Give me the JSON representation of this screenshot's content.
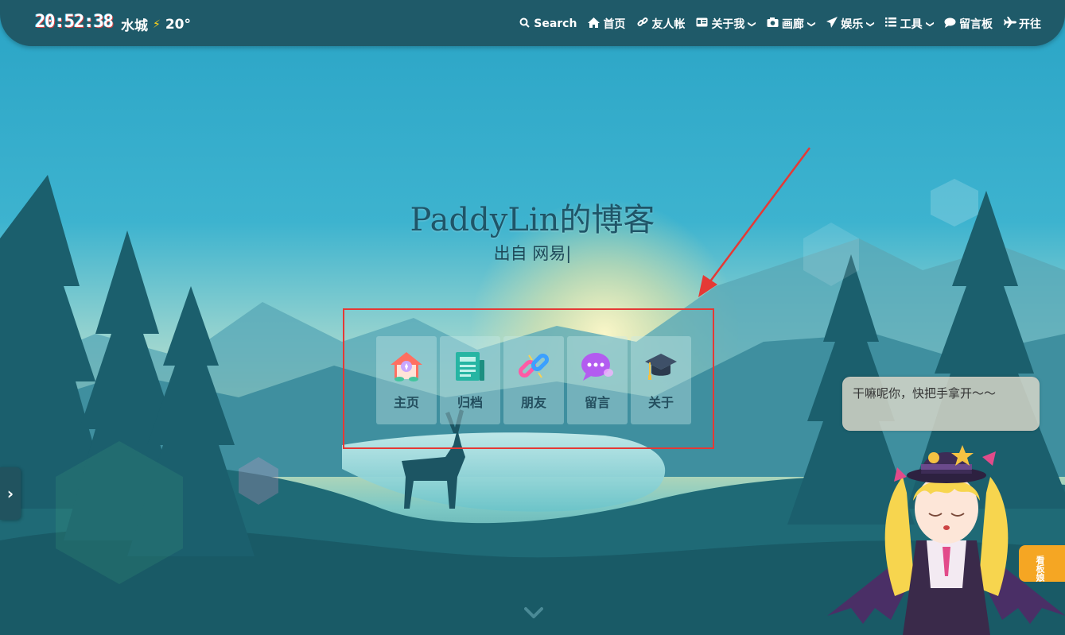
{
  "status": {
    "clock": "20:52:38",
    "city": "水城",
    "temperature": "20°"
  },
  "nav": {
    "items": [
      {
        "label": "Search",
        "icon": "search-icon",
        "dropdown": false
      },
      {
        "label": "首页",
        "icon": "home-icon",
        "dropdown": false
      },
      {
        "label": "友人帐",
        "icon": "link-icon",
        "dropdown": false
      },
      {
        "label": "关于我",
        "icon": "id-card-icon",
        "dropdown": true
      },
      {
        "label": "画廊",
        "icon": "camera-icon",
        "dropdown": true
      },
      {
        "label": "娱乐",
        "icon": "paper-plane-icon",
        "dropdown": true
      },
      {
        "label": "工具",
        "icon": "list-icon",
        "dropdown": true
      },
      {
        "label": "留言板",
        "icon": "comment-icon",
        "dropdown": false
      },
      {
        "label": "开往",
        "icon": "plane-icon",
        "dropdown": false
      }
    ]
  },
  "hero": {
    "title": "PaddyLin的博客",
    "subtitle": "出自 网易",
    "cursor": "|"
  },
  "quick_links": [
    {
      "label": "主页",
      "icon": "home-heart-icon"
    },
    {
      "label": "归档",
      "icon": "newspaper-icon"
    },
    {
      "label": "朋友",
      "icon": "link-chain-icon"
    },
    {
      "label": "留言",
      "icon": "chat-bubble-icon"
    },
    {
      "label": "关于",
      "icon": "graduation-cap-icon"
    }
  ],
  "side_handle": {
    "glyph": "›"
  },
  "mascot": {
    "speech": "干嘛呢你，快把手拿开～～",
    "tab_label": "看板娘"
  },
  "colors": {
    "topbar": "#1f5a69",
    "highlight": "#e53935",
    "title": "#1f5568",
    "mascot_tab": "#f5a623"
  }
}
